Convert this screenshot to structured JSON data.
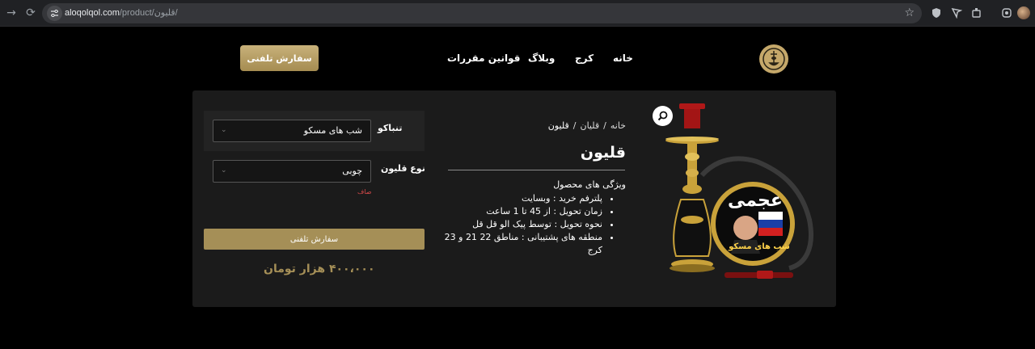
{
  "browser": {
    "url_host": "aloqolqol.com",
    "url_path": "/product/قلیون/"
  },
  "header": {
    "nav": [
      "خانه",
      "کرج",
      "وبلاگ",
      "قوانین مقررات"
    ],
    "phone_order_label": "سفارش تلفنی"
  },
  "product": {
    "breadcrumb": [
      "خانه",
      "قلیان",
      "قلیون"
    ],
    "title": "قلیون",
    "options": [
      {
        "label": "تنباکو",
        "value": "شب های مسکو"
      },
      {
        "label": "نوع قلیون",
        "value": "چوبی"
      }
    ],
    "clear_label": "صاف",
    "order_button_label": "سفارش تلفنی",
    "price": "۴۰۰،۰۰۰ هزار تومان",
    "features_heading": "ویژگی های محصول",
    "features": [
      "پلترفم خرید : وبسایت",
      "زمان تحویل : از 45 تا 1 ساعت",
      "نحوه تحویل : توسط پیک الو قل قل",
      "منطقه های پشتیبانی : مناطق 22 21 و 23 کرج"
    ],
    "image_labels": {
      "brand": "عجمی",
      "flavor": "شب های مسکو"
    }
  },
  "colors": {
    "gold": "#a58f57",
    "card_bg": "#1b1b1b",
    "page_bg": "#000000"
  }
}
